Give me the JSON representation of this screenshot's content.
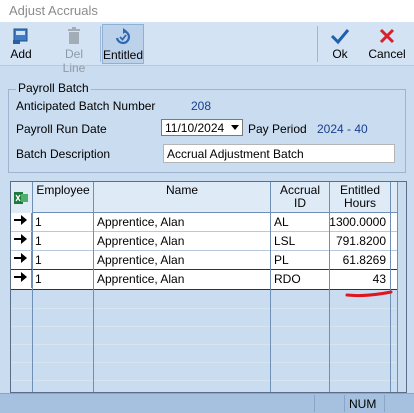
{
  "window": {
    "title": "Adjust Accruals"
  },
  "toolbar": {
    "add_label": "Add",
    "del_line_label": "Del Line",
    "entitled_label": "Entitled",
    "ok_label": "Ok",
    "cancel_label": "Cancel"
  },
  "payroll_batch": {
    "legend": "Payroll Batch",
    "anticipated_label": "Anticipated Batch Number",
    "anticipated_value": "208",
    "run_date_label": "Payroll Run Date",
    "run_date_value": "11/10/2024",
    "pay_period_label": "Pay Period",
    "pay_period_value": "2024 - 40",
    "description_label": "Batch Description",
    "description_value": "Accrual Adjustment Batch"
  },
  "grid": {
    "columns": [
      "Employee",
      "Name",
      "Accrual ID",
      "Entitled Hours"
    ],
    "rows": [
      {
        "employee": "1",
        "name": "Apprentice, Alan",
        "accrual_id": "AL",
        "hours": "1300.0000"
      },
      {
        "employee": "1",
        "name": "Apprentice, Alan",
        "accrual_id": "LSL",
        "hours": "791.8200"
      },
      {
        "employee": "1",
        "name": "Apprentice, Alan",
        "accrual_id": "PL",
        "hours": "61.8269"
      },
      {
        "employee": "1",
        "name": "Apprentice, Alan",
        "accrual_id": "RDO",
        "hours": "43"
      }
    ]
  },
  "status": {
    "num_label": "NUM"
  },
  "colors": {
    "accent_blue": "#1a3f8f",
    "annotation_red": "#e0161c"
  }
}
